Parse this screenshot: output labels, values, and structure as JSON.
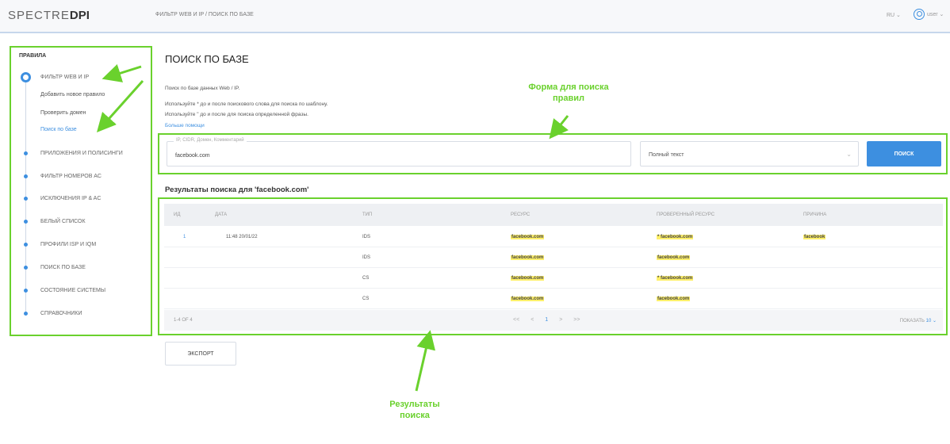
{
  "header": {
    "logo_light": "SPECTRE",
    "logo_bold": "DPI",
    "breadcrumb": "ФИЛЬТР WEB И IP / ПОИСК ПО БАЗЕ",
    "language": "RU ⌄",
    "user": "user ⌄"
  },
  "sidebar": {
    "title": "ПРАВИЛА",
    "active_item": "ФИЛЬТР WEB И IP",
    "sub_items": [
      "Добавить новое правило",
      "Проверить домен",
      "Поиск по базе"
    ],
    "items": [
      "ПРИЛОЖЕНИЯ И ПОЛИСИНГИ",
      "ФИЛЬТР НОМЕРОВ АС",
      "ИСКЛЮЧЕНИЯ IP & AC",
      "БЕЛЫЙ СПИСОК",
      "ПРОФИЛИ ISP И IQM",
      "ПОИСК ПО БАЗЕ",
      "СОСТОЯНИЕ СИСТЕМЫ",
      "СПРАВОЧНИКИ"
    ]
  },
  "main": {
    "title": "ПОИСК ПО БАЗЕ",
    "desc1": "Поиск по базе данных Web / IP.",
    "desc2": "Используйте * до и после поискового слова для поиска по шаблону.",
    "desc3": "Используйте \" до и после для поиска определенной фразы.",
    "help_link": "Больше помощи",
    "search": {
      "legend": "IP, CIDR, Домен, Комментарий",
      "value": "facebook.com",
      "mode": "Полный текст",
      "button": "ПОИСК"
    },
    "results_title": "Результаты поиска для 'facebook.com'",
    "table": {
      "headers": [
        "ИД",
        "ДАТА",
        "ТИП",
        "РЕСУРС",
        "ПРОВЕРЕННЫЙ РЕСУРС",
        "ПРИЧИНА"
      ],
      "rows": [
        {
          "id": "1",
          "date": "11:48 20/01/22",
          "type": "IDS",
          "resource": "facebook.com",
          "checked": "* facebook.com",
          "reason": "facebook"
        },
        {
          "id": "",
          "date": "",
          "type": "IDS",
          "resource": "facebook.com",
          "checked": "facebook.com",
          "reason": ""
        },
        {
          "id": "",
          "date": "",
          "type": "CS",
          "resource": "facebook.com",
          "checked": "* facebook.com",
          "reason": ""
        },
        {
          "id": "",
          "date": "",
          "type": "CS",
          "resource": "facebook.com",
          "checked": "facebook.com",
          "reason": ""
        }
      ],
      "footer_count": "1-4 OF 4",
      "pager": [
        "<<",
        "<",
        "1",
        ">",
        ">>"
      ],
      "show_label": "ПОКАЗАТЬ",
      "show_value": "10 ⌄"
    },
    "export": "ЭКСПОРТ"
  },
  "annotations": {
    "form_line1": "Форма для поиска",
    "form_line2": "правил",
    "results_line1": "Результаты",
    "results_line2": "поиска"
  },
  "colors": {
    "accent": "#3d8fe0",
    "annotation": "#6ad12d",
    "highlight": "#fff06a"
  }
}
